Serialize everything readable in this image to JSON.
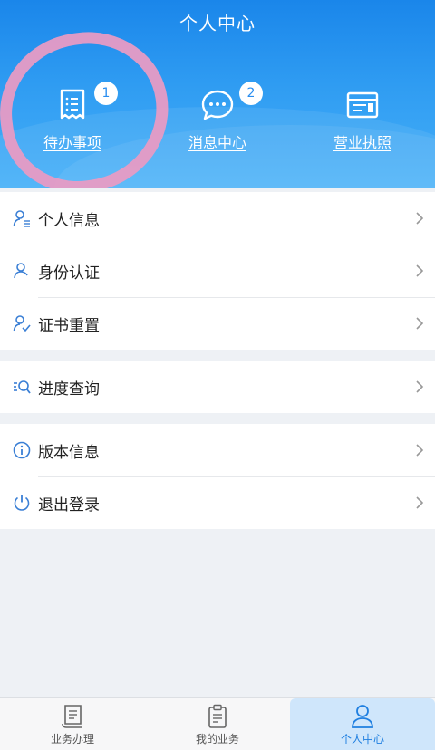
{
  "header": {
    "title": "个人中心",
    "quick_actions": [
      {
        "label": "待办事项",
        "badge": "1",
        "icon": "document-list-icon"
      },
      {
        "label": "消息中心",
        "badge": "2",
        "icon": "chat-bubble-icon"
      },
      {
        "label": "营业执照",
        "badge": "",
        "icon": "license-card-icon"
      }
    ]
  },
  "menu": {
    "group1": [
      {
        "label": "个人信息",
        "icon": "user-list-icon"
      },
      {
        "label": "身份认证",
        "icon": "user-icon"
      },
      {
        "label": "证书重置",
        "icon": "user-check-icon"
      }
    ],
    "group2": [
      {
        "label": "进度查询",
        "icon": "search-progress-icon"
      }
    ],
    "group3": [
      {
        "label": "版本信息",
        "icon": "info-icon"
      },
      {
        "label": "退出登录",
        "icon": "power-icon"
      }
    ]
  },
  "tabbar": {
    "items": [
      {
        "label": "业务办理",
        "icon": "book-icon"
      },
      {
        "label": "我的业务",
        "icon": "clipboard-icon"
      },
      {
        "label": "个人中心",
        "icon": "person-icon"
      }
    ],
    "active": "个人中心"
  },
  "colors": {
    "header_top": "#1a86ea",
    "header_bottom": "#46b0f8",
    "accent": "#1f7fe0",
    "highlight_circle": "#e79bc4",
    "background": "#eef1f5"
  }
}
